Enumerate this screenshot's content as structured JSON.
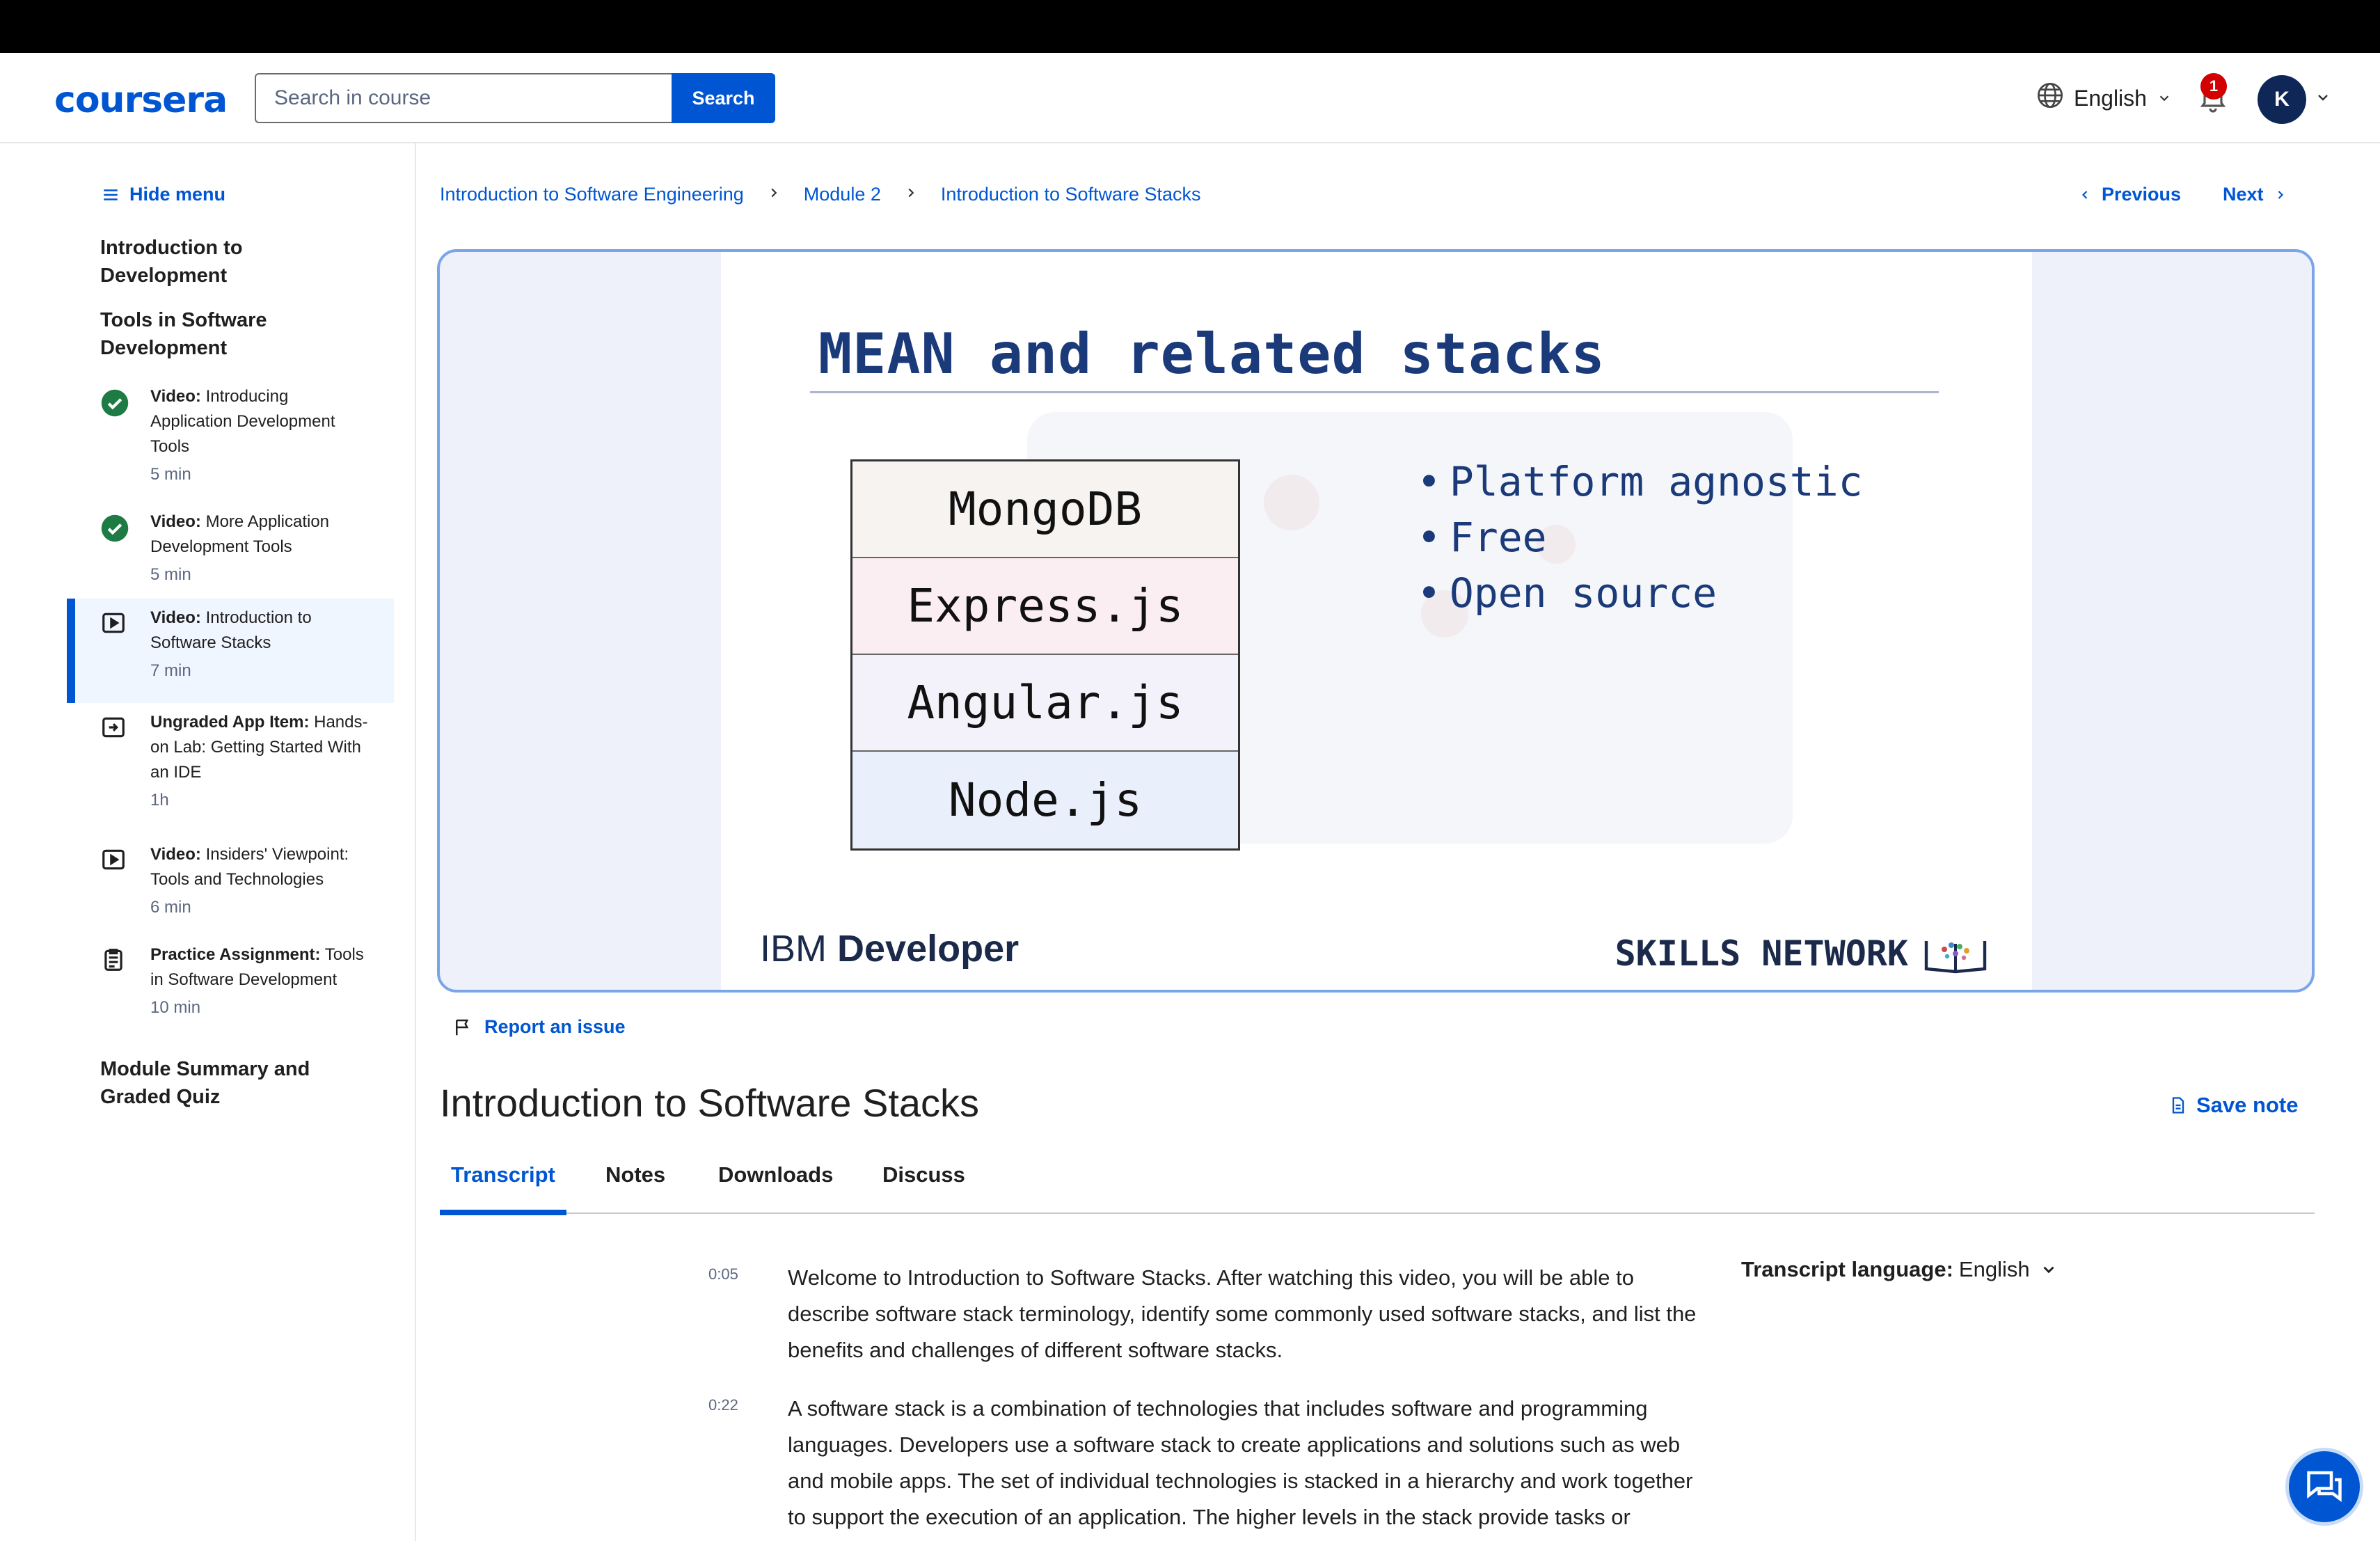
{
  "header": {
    "logo": "coursera",
    "search_placeholder": "Search in course",
    "search_button": "Search",
    "language": "English",
    "notification_count": "1",
    "avatar_initial": "K"
  },
  "sidebar": {
    "hide_menu": "Hide menu",
    "sections": [
      "Introduction to Development",
      "Tools in Software Development",
      "Module Summary and Graded Quiz"
    ],
    "items": [
      {
        "kind": "Video:",
        "title": "Introducing Application Development Tools",
        "duration": "5 min",
        "status": "completed",
        "icon": "check-circle-icon"
      },
      {
        "kind": "Video:",
        "title": "More Application Development Tools",
        "duration": "5 min",
        "status": "completed",
        "icon": "check-circle-icon"
      },
      {
        "kind": "Video:",
        "title": "Introduction to Software Stacks",
        "duration": "7 min",
        "status": "active",
        "icon": "play-icon"
      },
      {
        "kind": "Ungraded App Item:",
        "title": "Hands-on Lab: Getting Started With an IDE",
        "duration": "1h",
        "status": "todo",
        "icon": "app-item-icon"
      },
      {
        "kind": "Video:",
        "title": "Insiders' Viewpoint: Tools and Technologies",
        "duration": "6 min",
        "status": "todo",
        "icon": "play-icon"
      },
      {
        "kind": "Practice Assignment:",
        "title": "Tools in Software Development",
        "duration": "10 min",
        "status": "todo",
        "icon": "assignment-icon"
      }
    ]
  },
  "breadcrumb": [
    "Introduction to Software Engineering",
    "Module 2",
    "Introduction to Software Stacks"
  ],
  "nav": {
    "previous": "Previous",
    "next": "Next"
  },
  "slide": {
    "title": "MEAN and related stacks",
    "layers": [
      "MongoDB",
      "Express.js",
      "Angular.js",
      "Node.js"
    ],
    "layer_colors": [
      "#f6f3f1",
      "#fbeef3",
      "#f3f1f9",
      "#eaf0fb"
    ],
    "bullets": [
      "Platform agnostic",
      "Free",
      "Open source"
    ],
    "brand_left_light": "IBM",
    "brand_left_bold": "Developer",
    "brand_right": "SKILLS NETWORK"
  },
  "report_issue": "Report an issue",
  "lesson_title": "Introduction to Software Stacks",
  "save_note": "Save note",
  "tabs": [
    "Transcript",
    "Notes",
    "Downloads",
    "Discuss"
  ],
  "transcript": {
    "language_label": "Transcript language:",
    "language_value": "English",
    "paragraphs": [
      {
        "time": "0:05",
        "text": "Welcome to Introduction to Software Stacks. After watching this video, you will be able to describe software stack terminology, identify some commonly used software stacks, and list the benefits and challenges of different software stacks."
      },
      {
        "time": "0:22",
        "text": "A software stack is a combination of technologies that includes software and programming languages. Developers use a software stack to create applications and solutions such as web and mobile apps. The set of individual technologies is stacked in a hierarchy and work together to support the execution of an application. The higher levels in the stack provide tasks or services"
      }
    ]
  },
  "colors": {
    "brand": "#0056d2",
    "active_bg": "#f0f6ff",
    "complete": "#1e7b44",
    "badge": "#d30001"
  }
}
